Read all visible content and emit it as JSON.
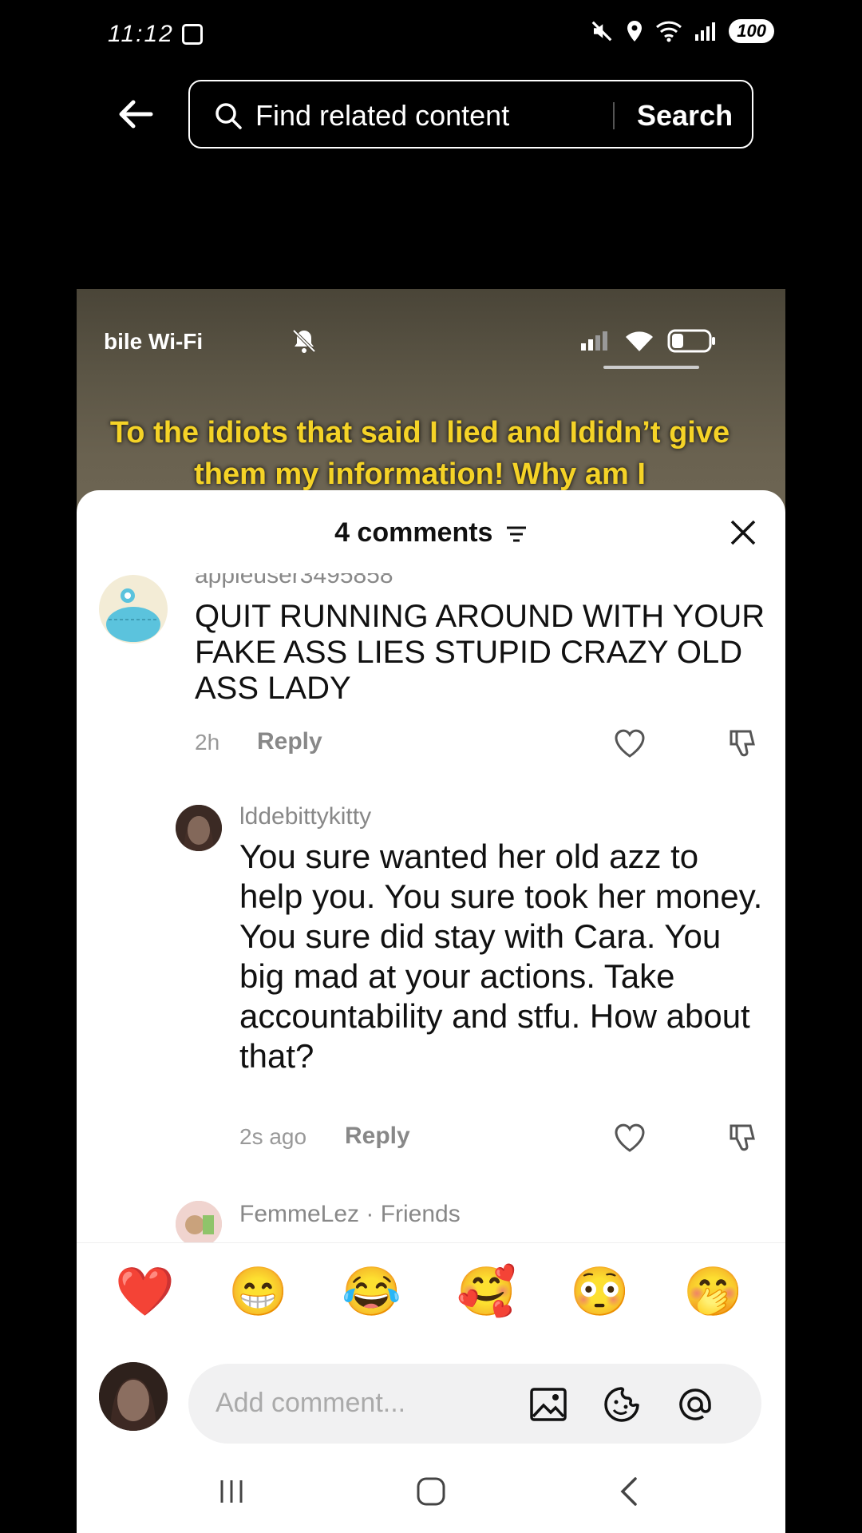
{
  "status_bar": {
    "time": "11:12",
    "battery": "100",
    "signal_label": "5"
  },
  "search": {
    "placeholder": "Find related content",
    "button": "Search"
  },
  "video": {
    "overlay_network": "bile Wi-Fi",
    "caption": "To the idiots that said I lied and Ididn’t give them my information! Why am I"
  },
  "comments_panel": {
    "title": "4 comments",
    "items": [
      {
        "username": "appleuser3495858",
        "text": "QUIT RUNNING AROUND WITH YOUR FAKE ASS LIES STUPID CRAZY OLD ASS LADY",
        "time": "2h",
        "reply_label": "Reply"
      },
      {
        "username": "lddebittykitty",
        "text": "You sure wanted her old azz to help you. You sure took her money. You sure did stay with Cara. You big mad at your actions. Take accountability and stfu. How about that?",
        "time": "2s ago",
        "reply_label": "Reply"
      },
      {
        "username": "FemmeLez · Friends"
      }
    ]
  },
  "emoji_bar": [
    "❤️",
    "😁",
    "😂",
    "🥰",
    "😳",
    "🤭"
  ],
  "composer": {
    "placeholder": "Add comment..."
  },
  "colors": {
    "caption": "#f5d327",
    "heart": "#f0304d"
  }
}
